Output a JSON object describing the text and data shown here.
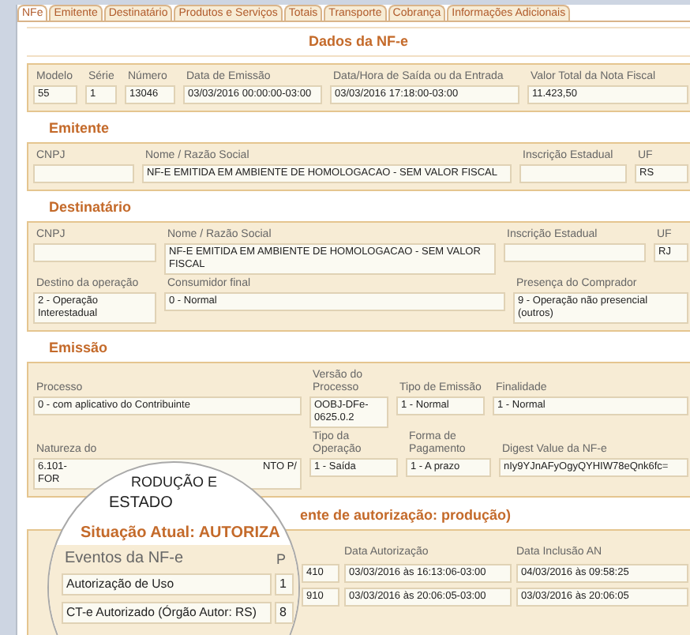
{
  "tabs": [
    {
      "label": "NFe",
      "selected": true
    },
    {
      "label": "Emitente",
      "selected": false
    },
    {
      "label": "Destinatário",
      "selected": false
    },
    {
      "label": "Produtos e Serviços",
      "selected": false
    },
    {
      "label": "Totais",
      "selected": false
    },
    {
      "label": "Transporte",
      "selected": false
    },
    {
      "label": "Cobrança",
      "selected": false
    },
    {
      "label": "Informações Adicionais",
      "selected": false
    }
  ],
  "title": "Dados da NF-e",
  "sections": [
    {
      "rows": [
        [
          {
            "label": "Modelo",
            "value": "55"
          },
          {
            "label": "Série",
            "value": "1"
          },
          {
            "label": "Número",
            "value": "13046"
          },
          {
            "label": "Data de Emissão",
            "value": "03/03/2016 00:00:00-03:00"
          },
          {
            "label": "Data/Hora de Saída ou da Entrada",
            "value": "03/03/2016 17:18:00-03:00"
          },
          {
            "label": "Valor Total da Nota Fiscal",
            "value": "11.423,50"
          }
        ]
      ]
    },
    {
      "heading": "Emitente",
      "rows": [
        [
          {
            "label": "CNPJ"
          },
          {
            "label": "Nome / Razão Social",
            "value": "NF-E EMITIDA EM AMBIENTE DE HOMOLOGACAO - SEM VALOR FISCAL"
          },
          {
            "label": "Inscrição Estadual"
          },
          {
            "label": "UF",
            "value": "RS"
          }
        ]
      ]
    },
    {
      "heading": "Destinatário",
      "rows": [
        [
          {
            "label": "CNPJ"
          },
          {
            "label": "Nome / Razão Social",
            "value": "NF-E EMITIDA EM AMBIENTE DE HOMOLOGACAO - SEM VALOR FISCAL"
          },
          {
            "label": "Inscrição Estadual"
          },
          {
            "label": "UF",
            "value": "RJ"
          }
        ],
        [
          {
            "label": "Destino da operação",
            "value": "2 - Operação Interestadual"
          },
          {
            "label": "Consumidor final",
            "value": "0 - Normal"
          },
          {
            "label": "Presença do Comprador",
            "value": "9 - Operação não presencial (outros)"
          }
        ]
      ]
    },
    {
      "heading": "Emissão",
      "rows": [
        [
          {
            "label": "Processo",
            "value": "0 - com aplicativo do Contribuinte"
          },
          {
            "label": "Versão do Processo",
            "value": "OOBJ-DFe-0625.0.2"
          },
          {
            "label": "Tipo de Emissão",
            "value": "1 - Normal"
          },
          {
            "label": "Finalidade",
            "value": "1 - Normal"
          }
        ],
        [
          {
            "label": "Natureza do",
            "value": "6.101- FOR",
            "value_end": "NTO P/"
          },
          {
            "label": "Tipo da Operação",
            "value": "1 - Saída"
          },
          {
            "label": "Forma de Pagamento",
            "value": "1 - A prazo"
          },
          {
            "label": "Digest Value da NF-e",
            "value": "nIy9YJnAFyOgyQYHIW78eQnk6fc="
          }
        ]
      ]
    }
  ],
  "status_fragment": "ente de autorização: produção)",
  "events": {
    "columns": [
      "Data Autorização",
      "Data Inclusão AN"
    ],
    "rows": [
      {
        "protocol": "410",
        "authorized": "03/03/2016 às 16:13:06-03:00",
        "included": "04/03/2016 às 09:58:25"
      },
      {
        "protocol": "910",
        "authorized": "03/03/2016 às 20:06:05-03:00",
        "included": "03/03/2016 às 20:06:05"
      }
    ]
  },
  "magnifier": {
    "nature_top": "RODUÇÃO E",
    "nature": "ESTADO",
    "status": "Situação Atual: AUTORIZA",
    "events_title": "Eventos da NF-e",
    "protocol_header": "P",
    "events": [
      {
        "name": "Autorização de Uso",
        "protocol": "1"
      },
      {
        "name": "CT-e Autorizado (Órgão Autor: RS)",
        "protocol": "8"
      }
    ]
  }
}
